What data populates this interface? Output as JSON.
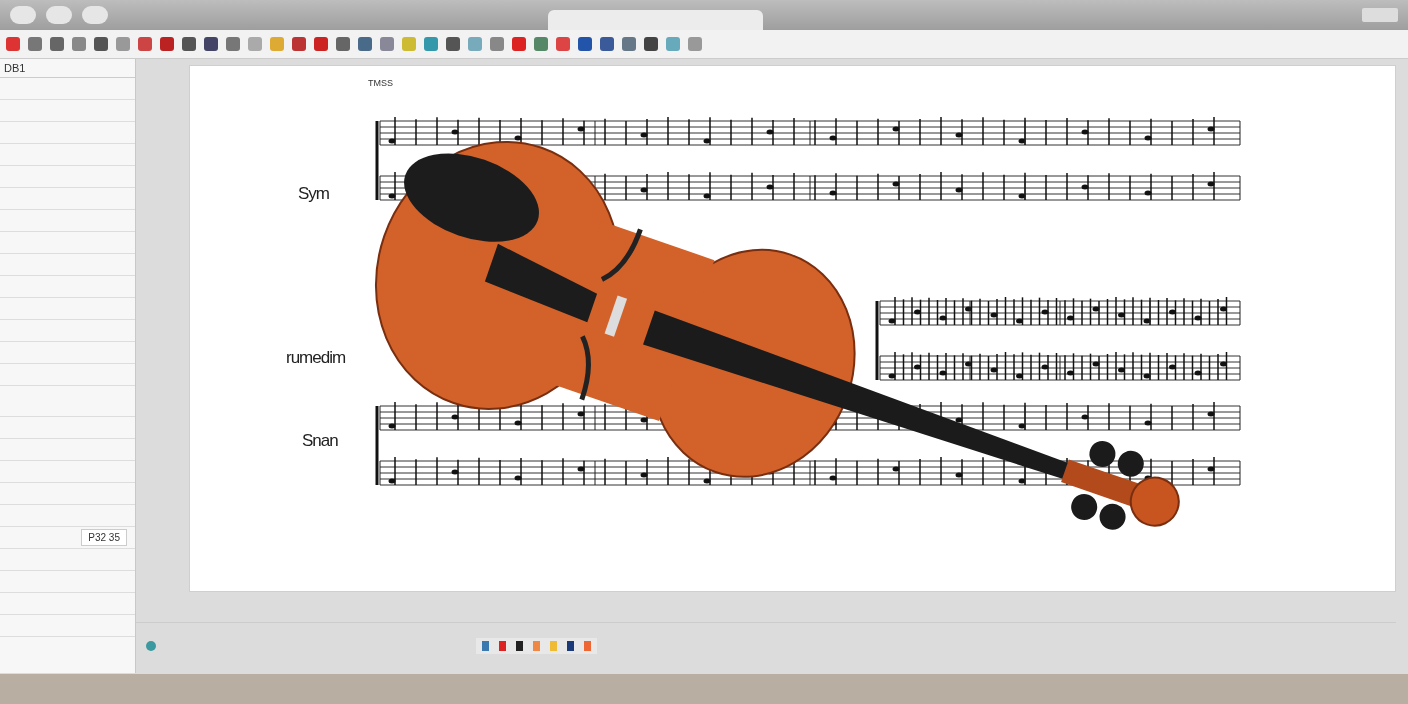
{
  "score": {
    "heading": "TMSS",
    "staves": [
      {
        "label": "Sym"
      },
      {
        "label": "rumedim"
      },
      {
        "label": "Snan"
      }
    ]
  },
  "sidebar": {
    "title": "DB1",
    "cells": [
      {
        "label": "P32 35"
      }
    ]
  }
}
